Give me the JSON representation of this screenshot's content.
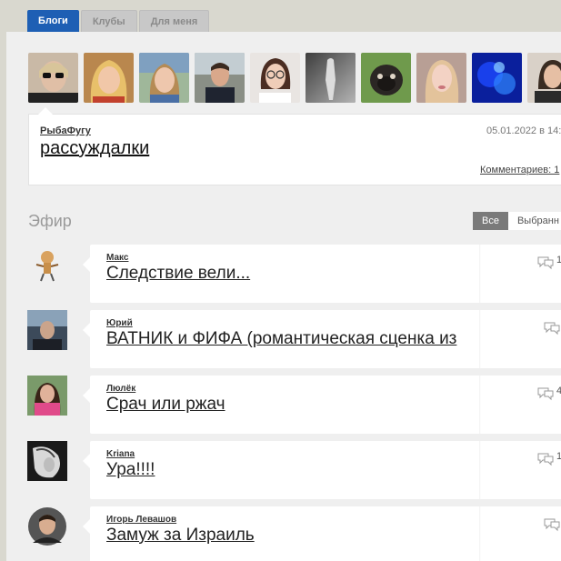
{
  "tabs": [
    {
      "label": "Блоги"
    },
    {
      "label": "Клубы"
    },
    {
      "label": "Для меня"
    }
  ],
  "avatars": [
    {
      "name": "woman-sunglasses-avatar"
    },
    {
      "name": "blonde-woman-avatar"
    },
    {
      "name": "woman-outdoors-avatar"
    },
    {
      "name": "man-avatar"
    },
    {
      "name": "woman-glasses-avatar"
    },
    {
      "name": "statue-avatar"
    },
    {
      "name": "pug-avatar"
    },
    {
      "name": "woman-portrait-avatar"
    },
    {
      "name": "blue-abstract-avatar"
    },
    {
      "name": "woman-dark-avatar"
    }
  ],
  "post": {
    "author": "РыбаФугу",
    "title": "рассуждалки",
    "date": "05.01.2022 в 14:",
    "comments": "Комментариев: 1"
  },
  "efir": {
    "title": "Эфир",
    "filter_all": "Все",
    "filter_selected": "Выбранн"
  },
  "feed": [
    {
      "author": "Макс",
      "title": "Следствие вели...",
      "count": "1"
    },
    {
      "author": "Юрий",
      "title": "ВАТНИК и ФИФА (романтическая сценка из",
      "count": ""
    },
    {
      "author": "Люлёк",
      "title": "Срач или ржач",
      "count": "4"
    },
    {
      "author": "Kriana",
      "title": "Ура!!!!",
      "count": "1"
    },
    {
      "author": "Игорь Левашов",
      "title": "Замуж за Израиль",
      "count": ""
    }
  ],
  "colors": {
    "page_bg": "#d9d8cf",
    "active_tab": "#1e5fb4",
    "panel_bg": "#efefef",
    "card_bg": "#ffffff"
  }
}
